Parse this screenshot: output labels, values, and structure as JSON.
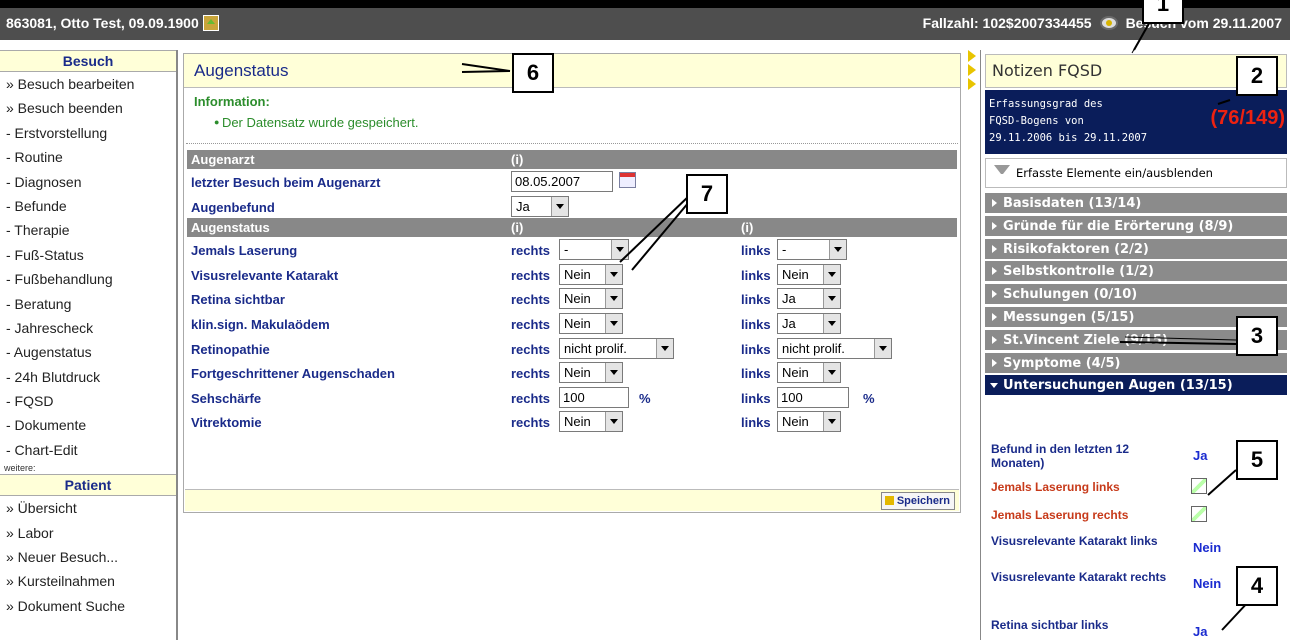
{
  "header": {
    "patient": "863081, Otto Test, 09.09.1900",
    "case_number": "Fallzahl: 102$2007334455",
    "visit": "Besuch vom 29.11.2007"
  },
  "sidebar": {
    "besuch_title": "Besuch",
    "besuch_items": [
      "» Besuch bearbeiten",
      "» Besuch beenden",
      "- Erstvorstellung",
      "- Routine",
      "- Diagnosen",
      "- Befunde",
      "- Therapie",
      "- Fuß-Status",
      "- Fußbehandlung",
      "- Beratung",
      "- Jahrescheck",
      "- Augenstatus",
      "- 24h Blutdruck",
      "- FQSD",
      "- Dokumente",
      "- Chart-Edit"
    ],
    "more": "weitere:",
    "patient_title": "Patient",
    "patient_items": [
      "» Übersicht",
      "» Labor",
      "» Neuer Besuch...",
      "» Kursteilnahmen",
      "» Dokument Suche"
    ]
  },
  "main": {
    "title": "Augenstatus",
    "info_title": "Information:",
    "info_msg": "Der Datensatz wurde gespeichert.",
    "sect1": {
      "label": "Augenarzt",
      "info": "(i)"
    },
    "last_visit_label": "letzter Besuch beim Augenarzt",
    "last_visit_value": "08.05.2007",
    "befund_label": "Augenbefund",
    "befund_value": "Ja",
    "sect2": {
      "label": "Augenstatus",
      "info_r": "(i)",
      "info_l": "(i)"
    },
    "right_label": "rechts",
    "left_label": "links",
    "pct": "%",
    "rows": [
      {
        "label": "Jemals Laserung",
        "r": "-",
        "l": "-"
      },
      {
        "label": "Visusrelevante Katarakt",
        "r": "Nein",
        "l": "Nein"
      },
      {
        "label": "Retina sichtbar",
        "r": "Nein",
        "l": "Ja"
      },
      {
        "label": "klin.sign. Makulaödem",
        "r": "Nein",
        "l": "Ja"
      },
      {
        "label": "Retinopathie",
        "r": "nicht prolif.",
        "l": "nicht prolif."
      },
      {
        "label": "Fortgeschrittener Augenschaden",
        "r": "Nein",
        "l": "Nein"
      },
      {
        "label": "Sehschärfe",
        "r": "100",
        "l": "100"
      },
      {
        "label": "Vitrektomie",
        "r": "Nein",
        "l": "Nein"
      }
    ],
    "save": "Speichern"
  },
  "notes": {
    "title": "Notizen  FQSD",
    "stat_line1": "Erfassungsgrad des",
    "stat_line2": "FQSD-Bogens von",
    "stat_line3": "29.11.2006 bis 29.11.2007",
    "stat_value": "(76/149)",
    "toggle": "Erfasste Elemente ein/ausblenden",
    "categories": [
      "Basisdaten (13/14)",
      "Gründe für die Erörterung (8/9)",
      "Risikofaktoren (2/2)",
      "Selbstkontrolle (1/2)",
      "Schulungen (0/10)",
      "Messungen (5/15)",
      "St.Vincent Ziele (9/15)",
      "Symptome (4/5)",
      "Untersuchungen Augen (13/15)"
    ],
    "entries": [
      {
        "label": "Befund in den letzten 12 Monaten)",
        "value": "Ja"
      },
      {
        "label": "Jemals Laserung links",
        "value": ""
      },
      {
        "label": "Jemals Laserung rechts",
        "value": ""
      },
      {
        "label": "Visusrelevante Katarakt links",
        "value": "Nein"
      },
      {
        "label": "Visusrelevante Katarakt rechts",
        "value": "Nein"
      },
      {
        "label": "Retina sichtbar links",
        "value": "Ja"
      }
    ]
  },
  "callouts": [
    "1",
    "2",
    "3",
    "4",
    "5",
    "6",
    "7"
  ]
}
